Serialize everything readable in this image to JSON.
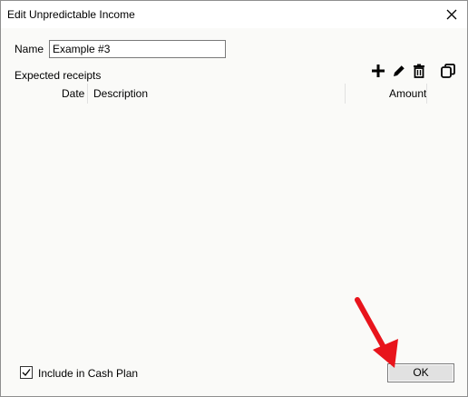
{
  "window": {
    "title": "Edit Unpredictable Income"
  },
  "form": {
    "name_label": "Name",
    "name_value": "Example #3",
    "receipts_label": "Expected receipts"
  },
  "toolbar": {
    "icons": [
      "add-icon",
      "edit-icon",
      "delete-icon",
      "copy-icon"
    ]
  },
  "table": {
    "columns": [
      "Date",
      "Description",
      "Amount"
    ],
    "rows": []
  },
  "footer": {
    "include_label": "Include in Cash Plan",
    "include_checked": true,
    "ok_label": "OK"
  },
  "annotation": {
    "arrow_color": "#e8141c"
  }
}
